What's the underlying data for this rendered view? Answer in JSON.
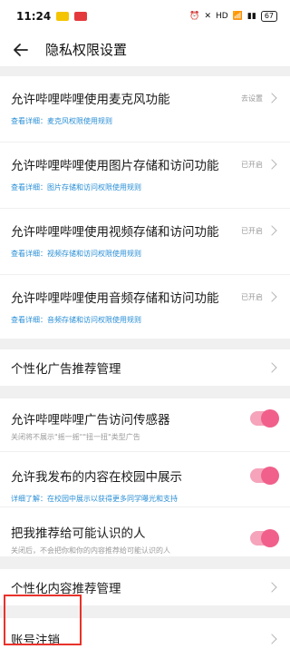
{
  "status_bar": {
    "time": "11:24",
    "badges": [
      "#f5c400",
      "#e4393c"
    ],
    "signal_text": "HD",
    "battery": "67"
  },
  "header": {
    "title": "隐私权限设置"
  },
  "permissions": [
    {
      "label": "允许哔哩哔哩使用麦克风功能",
      "status": "去设置",
      "detail_prefix": "查看详细：",
      "detail_link": "麦克风权限使用规则"
    },
    {
      "label": "允许哔哩哔哩使用图片存储和访问功能",
      "status": "已开启",
      "detail_prefix": "查看详细：",
      "detail_link": "图片存储和访问权限使用规则"
    },
    {
      "label": "允许哔哩哔哩使用视频存储和访问功能",
      "status": "已开启",
      "detail_prefix": "查看详细：",
      "detail_link": "视频存储和访问权限使用规则"
    },
    {
      "label": "允许哔哩哔哩使用音频存储和访问功能",
      "status": "已开启",
      "detail_prefix": "查看详细：",
      "detail_link": "音频存储和访问权限使用规则"
    }
  ],
  "ad_management": {
    "label": "个性化广告推荐管理"
  },
  "sensor": {
    "label": "允许哔哩哔哩广告访问传感器",
    "sub": "关闭将不展示\"摇一摇\"\"扭一扭\"类型广告",
    "enabled": true
  },
  "campus": {
    "label": "允许我发布的内容在校园中展示",
    "detail_prefix": "详细了解：",
    "detail_link": "在校园中展示以获得更多同学曝光和支持",
    "enabled": true
  },
  "recommend_contacts": {
    "label": "把我推荐给可能认识的人",
    "sub": "关闭后，不会把你和你的内容推荐给可能认识的人",
    "enabled": true
  },
  "content_management": {
    "label": "个性化内容推荐管理"
  },
  "account_cancel": {
    "label": "账号注销"
  },
  "colors": {
    "accent_pink": "#f0608a",
    "link_blue": "#2a8fd6",
    "highlight_red": "#e8322a"
  }
}
